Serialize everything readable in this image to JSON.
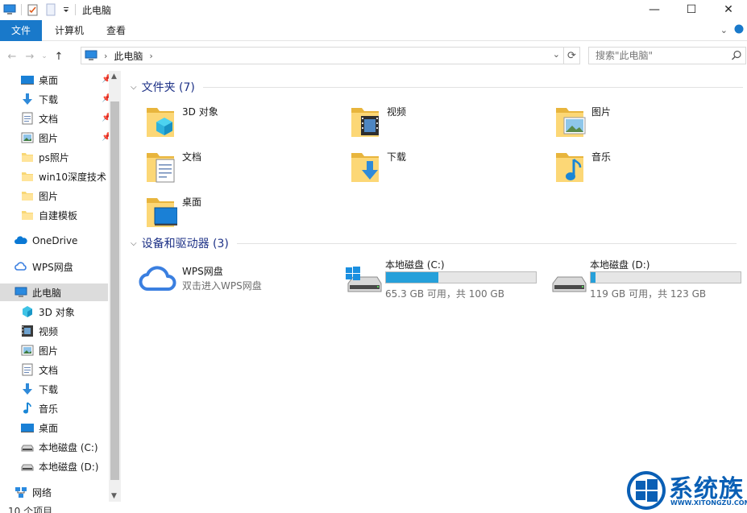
{
  "window": {
    "title": "此电脑",
    "minimize": "—",
    "maximize": "☐",
    "close": "✕"
  },
  "ribbon": {
    "tabs": [
      {
        "label": "文件",
        "active": true
      },
      {
        "label": "计算机"
      },
      {
        "label": "查看"
      }
    ],
    "accent": "#1979ca"
  },
  "address": {
    "crumb": "此电脑",
    "search_placeholder": "搜索\"此电脑\""
  },
  "nav": {
    "quick_access": [
      {
        "label": "桌面",
        "icon": "desktop-icon",
        "pinned": true
      },
      {
        "label": "下载",
        "icon": "download-icon",
        "pinned": true
      },
      {
        "label": "文档",
        "icon": "documents-icon",
        "pinned": true
      },
      {
        "label": "图片",
        "icon": "pictures-icon",
        "pinned": true
      },
      {
        "label": "ps照片",
        "icon": "folder-icon"
      },
      {
        "label": "win10深度技术",
        "icon": "folder-icon"
      },
      {
        "label": "图片",
        "icon": "folder-icon"
      },
      {
        "label": "自建模板",
        "icon": "folder-icon"
      }
    ],
    "onedrive": "OneDrive",
    "wps": "WPS网盘",
    "this_pc": "此电脑",
    "pc_children": [
      {
        "label": "3D 对象",
        "icon": "3d-objects-icon"
      },
      {
        "label": "视频",
        "icon": "videos-icon"
      },
      {
        "label": "图片",
        "icon": "pictures-icon"
      },
      {
        "label": "文档",
        "icon": "documents-icon"
      },
      {
        "label": "下载",
        "icon": "download-icon"
      },
      {
        "label": "音乐",
        "icon": "music-icon"
      },
      {
        "label": "桌面",
        "icon": "desktop-icon"
      },
      {
        "label": "本地磁盘 (C:)",
        "icon": "drive-icon"
      },
      {
        "label": "本地磁盘 (D:)",
        "icon": "drive-icon"
      }
    ],
    "network": "网络"
  },
  "content": {
    "folders_header": "文件夹 (7)",
    "folders": [
      {
        "label": "3D 对象",
        "icon": "3d-objects-folder-icon"
      },
      {
        "label": "视频",
        "icon": "videos-folder-icon"
      },
      {
        "label": "图片",
        "icon": "pictures-folder-icon"
      },
      {
        "label": "文档",
        "icon": "documents-folder-icon"
      },
      {
        "label": "下载",
        "icon": "downloads-folder-icon"
      },
      {
        "label": "音乐",
        "icon": "music-folder-icon"
      },
      {
        "label": "桌面",
        "icon": "desktop-folder-icon"
      }
    ],
    "devices_header": "设备和驱动器 (3)",
    "wps": {
      "label": "WPS网盘",
      "sub": "双击进入WPS网盘"
    },
    "drives": [
      {
        "label": "本地磁盘 (C:)",
        "free": "65.3 GB 可用，共 100 GB",
        "used_fraction": 0.347,
        "icon": "windows-drive-icon"
      },
      {
        "label": "本地磁盘 (D:)",
        "free": "119 GB 可用，共 123 GB",
        "used_fraction": 0.033,
        "icon": "drive-icon"
      }
    ]
  },
  "status": {
    "count": "10 个项目"
  },
  "watermark": {
    "title": "系统族",
    "url": "WWW.XITONGZU.COM"
  }
}
